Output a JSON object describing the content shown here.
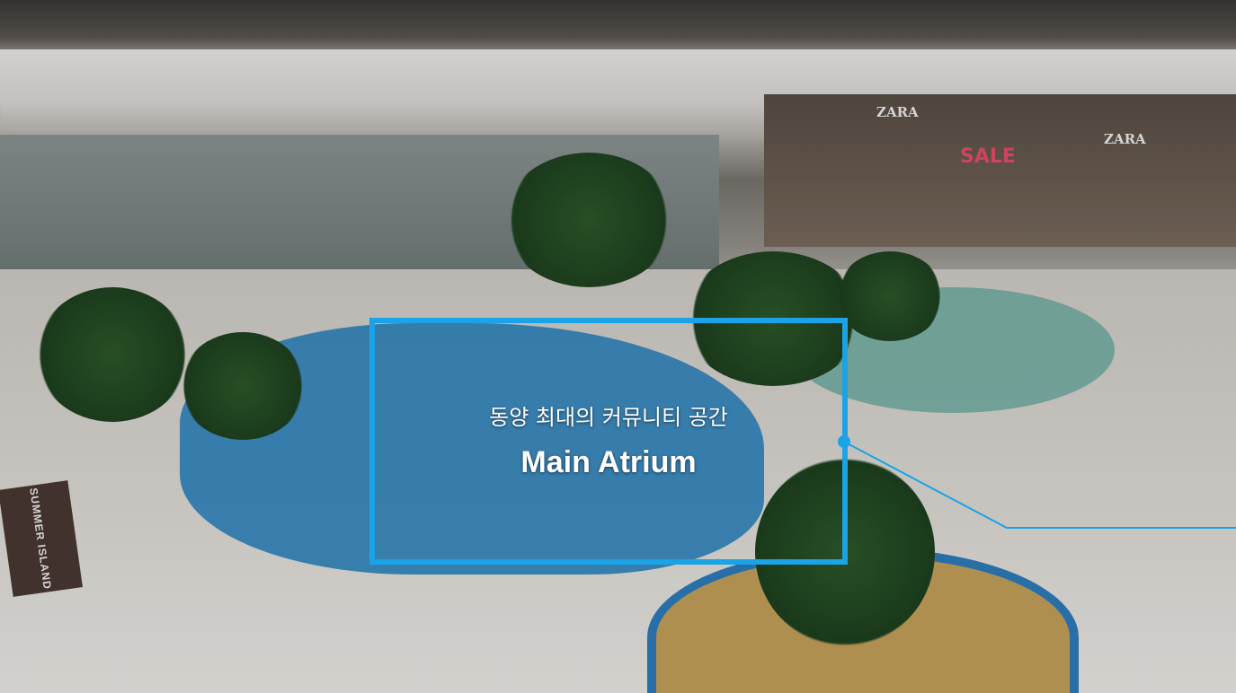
{
  "hotspot": {
    "subtitle": "동양 최대의 커뮤니티 공간",
    "title": "Main Atrium",
    "accent_color": "#1aa3e6"
  },
  "scene_signs": {
    "zara_1": "ZARA",
    "zara_2": "ZARA",
    "sale": "SALE",
    "island": "SUMMER ISLAND"
  },
  "icons": {
    "connector_dot": "dot-marker-icon"
  }
}
